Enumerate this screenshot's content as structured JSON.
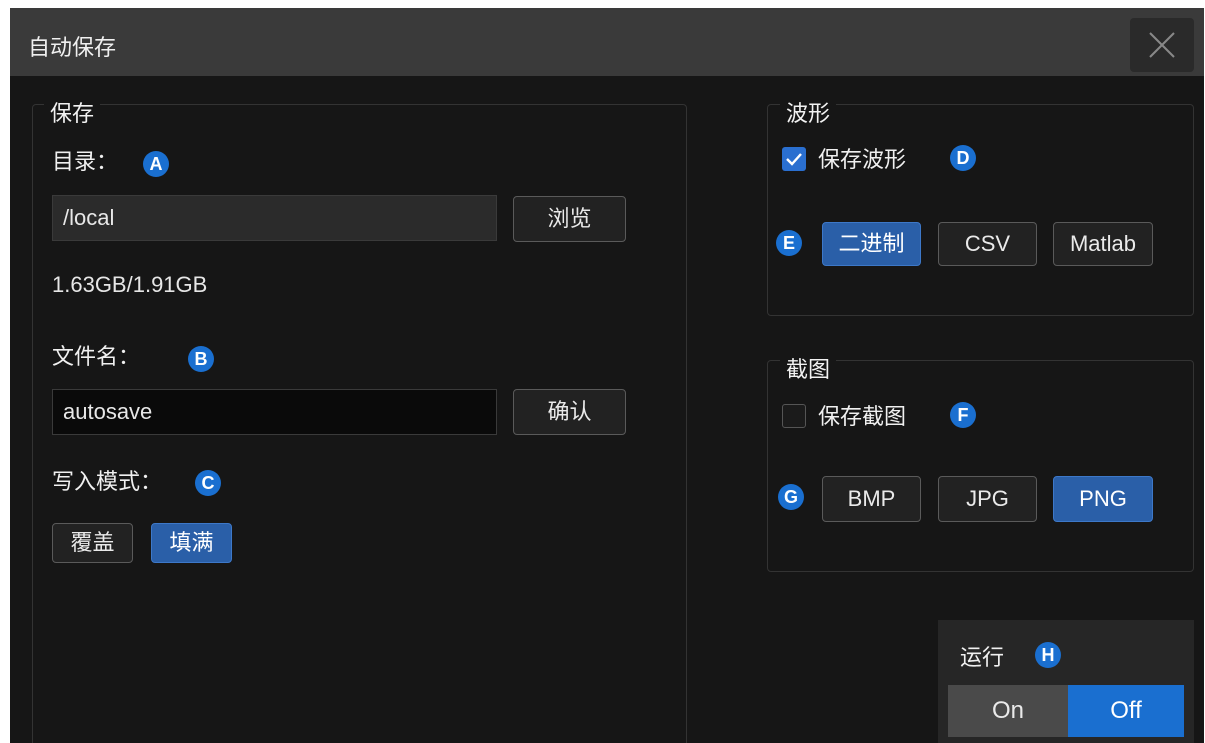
{
  "dialog": {
    "title": "自动保存",
    "close_icon": "close-icon"
  },
  "save_group": {
    "title": "保存",
    "directory_label": "目录：",
    "directory_badge": "A",
    "directory_value": "/local",
    "browse_label": "浏览",
    "storage": "1.63GB/1.91GB",
    "filename_label": "文件名：",
    "filename_badge": "B",
    "filename_value": "autosave",
    "confirm_label": "确认",
    "write_mode_label": "写入模式：",
    "write_mode_badge": "C",
    "write_modes": [
      "覆盖",
      "填满"
    ],
    "write_mode_selected": "填满"
  },
  "waveform_group": {
    "title": "波形",
    "save_label": "保存波形",
    "save_checked": true,
    "save_badge": "D",
    "format_badge": "E",
    "formats": [
      "二进制",
      "CSV",
      "Matlab"
    ],
    "format_selected": "二进制"
  },
  "screenshot_group": {
    "title": "截图",
    "save_label": "保存截图",
    "save_checked": false,
    "save_badge": "F",
    "format_badge": "G",
    "formats": [
      "BMP",
      "JPG",
      "PNG"
    ],
    "format_selected": "PNG"
  },
  "run": {
    "label": "运行",
    "badge": "H",
    "on_label": "On",
    "off_label": "Off",
    "state": "Off"
  },
  "colors": {
    "accent": "#1a6fd0",
    "selected_button": "#2a5fa8",
    "background": "#161616",
    "titlebar": "#3a3a3a"
  }
}
